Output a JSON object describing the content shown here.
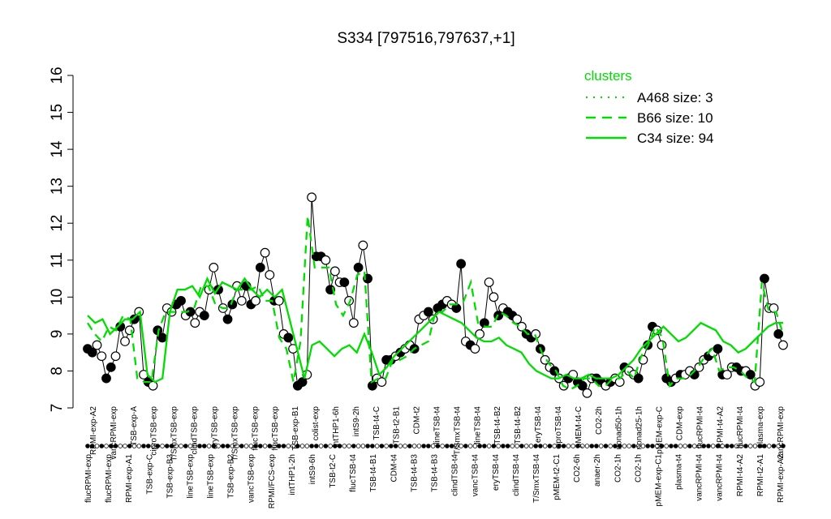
{
  "chart_data": {
    "type": "line",
    "title": "S334 [797516,797637,+1]",
    "ylim": [
      7,
      16
    ],
    "yticks": [
      7,
      8,
      9,
      10,
      11,
      12,
      13,
      14,
      15,
      16
    ],
    "grid": false,
    "legend": {
      "title": "clusters",
      "placement": "top-right",
      "color": "#00dd00",
      "entries": [
        {
          "label": "A468 size: 3",
          "style": "dotted"
        },
        {
          "label": "B66 size: 10",
          "style": "dashed"
        },
        {
          "label": "C34 size: 94",
          "style": "solid"
        }
      ]
    },
    "bottom_labels": [
      "flucRPMI-exp",
      "flucRPMI-exp",
      "RPMI-exp-A1",
      "TSB-exp-C",
      "TSB-exp-B3",
      "lineTSB-exp",
      "lineTSB-exp",
      "TSB-exp-B2",
      "vancTSB-exp",
      "RPMI/FCS-exp",
      "intTHP1-2h",
      "intS9-6h",
      "TSB-t2-C",
      "flucTSB-t4",
      "TSB-t4-B1",
      "CDM-t4",
      "TSB-t4-B3",
      "TSB-t4-B3",
      "clindTSB-t4",
      "vancTSB-t4",
      "eryTSB-t4",
      "clindTSB-t4",
      "T/SmxTSB-t4",
      "pMEM-t2-C1",
      "CO2-6h",
      "anaer-2h",
      "CO2-1h",
      "CO2-1h",
      "pMEM-exp-C1",
      "plasma-t4",
      "vancRPMI-t4",
      "vancRPMI-t4",
      "RPMI-t4-A2",
      "RPMI-t2-A1",
      "RPMI-exp-A2"
    ],
    "top_labels": [
      "RPMI-exp-A2",
      "vancRPMI-exp",
      "TSB-exp-A",
      "ciproTSB-exp",
      "T/SmxTSB-exp",
      "clindTSB-exp",
      "eryTSB-exp",
      "T/SmxTSB-exp",
      "flucTSB-exp",
      "flucTSB-exp",
      "TSB-exp-B1",
      "colist-exp",
      "intTHP1-6h",
      "intS9-2h",
      "TSB-t4-C",
      "TSB-t2-B1",
      "CDM-t2",
      "lineTSB-t4",
      "T/SmxTSB-t4",
      "lineTSB-t4",
      "TSB-t4-B2",
      "TSB-t4-B2",
      "eryTSB-t4",
      "ciproTSB-t4",
      "pMEM-t4-C",
      "CO2-2h",
      "nonad50-1h",
      "nonad25-1h",
      "pMEM-exp-C",
      "CDM-exp",
      "flucRPMI-t4",
      "RPMI-t4-A2",
      "flucRPMI-t4",
      "plasma-exp",
      "vancRPMI-exp"
    ],
    "series": [
      {
        "style": "line",
        "values": [
          8.6,
          8.5,
          8.7,
          8.4,
          7.8,
          8.1,
          8.4,
          9.2,
          8.8,
          9.1,
          9.4,
          9.6,
          7.9,
          7.7,
          7.6,
          9.1,
          8.9,
          9.7,
          9.6,
          9.8,
          9.9,
          9.5,
          9.6,
          9.3,
          9.6,
          9.5,
          10.2,
          10.8,
          10.2,
          9.7,
          9.4,
          9.8,
          10.3,
          9.9,
          10.3,
          9.8,
          9.9,
          10.8,
          11.2,
          10.6,
          9.9,
          9.9,
          9.0,
          8.9,
          8.6,
          7.6,
          7.7,
          7.9,
          12.7,
          11.1,
          11.1,
          11.0,
          10.2,
          10.7,
          10.4,
          10.4,
          9.9,
          9.3,
          10.8,
          11.4,
          10.5,
          7.6,
          7.8,
          7.7,
          8.3,
          8.3,
          8.4,
          8.5,
          8.6,
          8.7,
          8.6,
          9.4,
          9.5,
          9.6,
          9.4,
          9.7,
          9.8,
          9.9,
          9.8,
          9.7,
          10.9,
          8.8,
          8.7,
          8.6,
          9.0,
          9.3,
          10.4,
          10.0,
          9.5,
          9.7,
          9.6,
          9.5,
          9.4,
          9.2,
          9.0,
          8.9,
          9.0,
          8.6,
          8.3,
          8.1,
          8.0,
          7.8,
          7.6,
          7.8,
          7.9,
          7.7,
          7.6,
          7.4,
          7.8,
          7.8,
          7.7,
          7.6,
          7.7,
          7.8,
          7.7,
          8.1,
          8.0,
          7.9,
          7.8,
          8.3,
          8.7,
          9.2,
          9.1,
          8.7,
          7.8,
          7.7,
          7.8,
          7.9,
          7.9,
          8.0,
          7.9,
          8.1,
          8.3,
          8.4,
          8.5,
          8.6,
          7.9,
          7.9,
          8.1,
          8.1,
          8.0,
          8.0,
          7.9,
          7.6,
          7.7,
          10.5,
          9.7,
          9.7,
          9.0,
          8.7
        ]
      },
      {
        "name": "A468 size: 3",
        "style": "dotted",
        "values": []
      },
      {
        "name": "B66 size: 10",
        "style": "dashed",
        "values": [
          9.3,
          9.0,
          8.8,
          9.2,
          9.1,
          9.5,
          9.4,
          7.8,
          7.7,
          7.7,
          9.1,
          9.6,
          9.6,
          9.6,
          9.6,
          9.7,
          10.3,
          10.3,
          9.8,
          9.7,
          9.7,
          10.2,
          10.2,
          10.2,
          10.3,
          9.9,
          9.9,
          8.9,
          8.6,
          7.7,
          8.8,
          12.2,
          10.8,
          10.8,
          10.8,
          9.8,
          9.5,
          9.9,
          10.6,
          10.7,
          7.7,
          7.8,
          7.8,
          8.3,
          8.3,
          8.4,
          8.6,
          8.7,
          8.8,
          9.6,
          9.6,
          9.8,
          9.8,
          9.9,
          10.4,
          9.3,
          9.2,
          9.2,
          9.6,
          9.5,
          9.3,
          9.2,
          9.0,
          9.0,
          8.5,
          8.2,
          8.0,
          7.6,
          7.5,
          7.6,
          7.8,
          7.8,
          7.6,
          7.6,
          7.8,
          7.8,
          8.0,
          7.8,
          8.4,
          8.7,
          9.2,
          8.9,
          7.6,
          7.8,
          7.8,
          7.9,
          8.1,
          8.4,
          8.6,
          8.0,
          8.1,
          8.1,
          8.0,
          7.8,
          7.7,
          10.4,
          9.6,
          9.6,
          9.0
        ]
      },
      {
        "name": "C34 size: 94",
        "style": "solid",
        "values": [
          9.5,
          9.3,
          9.4,
          9.0,
          9.2,
          9.4,
          9.4,
          9.6,
          7.9,
          7.7,
          7.8,
          9.6,
          10.2,
          10.2,
          10.3,
          10.0,
          10.5,
          10.1,
          10.4,
          10.3,
          10.2,
          10.5,
          10.2,
          10.0,
          10.2,
          10.0,
          10.2,
          9.4,
          8.6,
          7.8,
          8.7,
          8.8,
          8.6,
          8.4,
          8.6,
          8.7,
          8.5,
          9.0,
          8.5,
          7.9,
          8.1,
          8.4,
          8.6,
          8.8,
          9.0,
          9.2,
          9.4,
          9.6,
          9.5,
          9.4,
          9.3,
          9.1,
          8.9,
          8.8,
          8.8,
          8.9,
          8.7,
          8.6,
          8.5,
          8.2,
          8.0,
          7.9,
          7.8,
          7.8,
          7.9,
          7.8,
          7.8,
          7.9,
          7.8,
          7.8,
          7.8,
          7.9,
          8.1,
          8.3,
          8.6,
          8.8,
          9.0,
          9.2,
          9.0,
          8.8,
          8.9,
          9.1,
          9.3,
          9.2,
          9.1,
          8.8,
          8.7,
          8.5,
          8.6,
          8.8,
          9.0,
          9.2,
          9.3,
          9.3
        ]
      }
    ]
  }
}
